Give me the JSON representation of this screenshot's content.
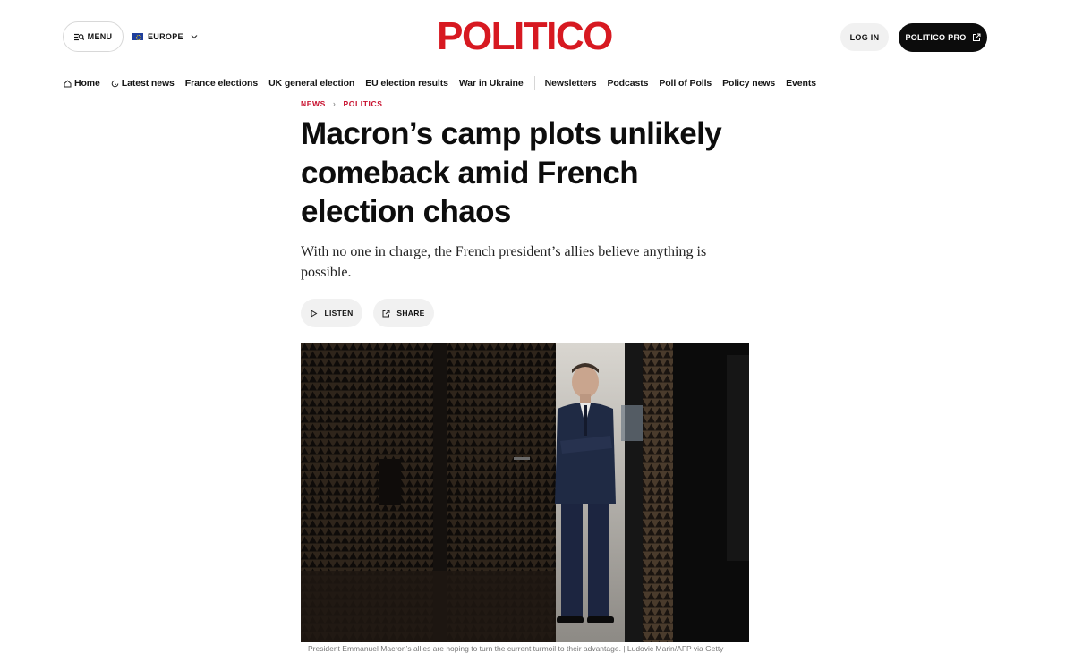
{
  "header": {
    "menu_label": "MENU",
    "region_label": "EUROPE",
    "logo_text": "POLITICO",
    "login_label": "LOG IN",
    "pro_label": "POLITICO PRO",
    "colors": {
      "brand_red": "#d71921",
      "pro_button_bg": "#0c0c0c"
    }
  },
  "nav": {
    "items": [
      {
        "label": "Home",
        "icon": "home-icon"
      },
      {
        "label": "Latest news",
        "icon": "clock-icon"
      },
      {
        "label": "France elections"
      },
      {
        "label": "UK general election"
      },
      {
        "label": "EU election results"
      },
      {
        "label": "War in Ukraine"
      },
      {
        "label": "Newsletters"
      },
      {
        "label": "Podcasts"
      },
      {
        "label": "Poll of Polls"
      },
      {
        "label": "Policy news"
      },
      {
        "label": "Events"
      }
    ]
  },
  "article": {
    "breadcrumb": [
      "NEWS",
      "POLITICS"
    ],
    "headline": "Macron’s camp plots unlikely comeback amid French election chaos",
    "dek": "With no one in charge, the French president’s allies believe anything is possible.",
    "listen_label": "LISTEN",
    "share_label": "SHARE",
    "caption": "President Emmanuel Macron’s allies are hoping to turn the current turmoil to their advantage. | Ludovic Marin/AFP via Getty"
  }
}
